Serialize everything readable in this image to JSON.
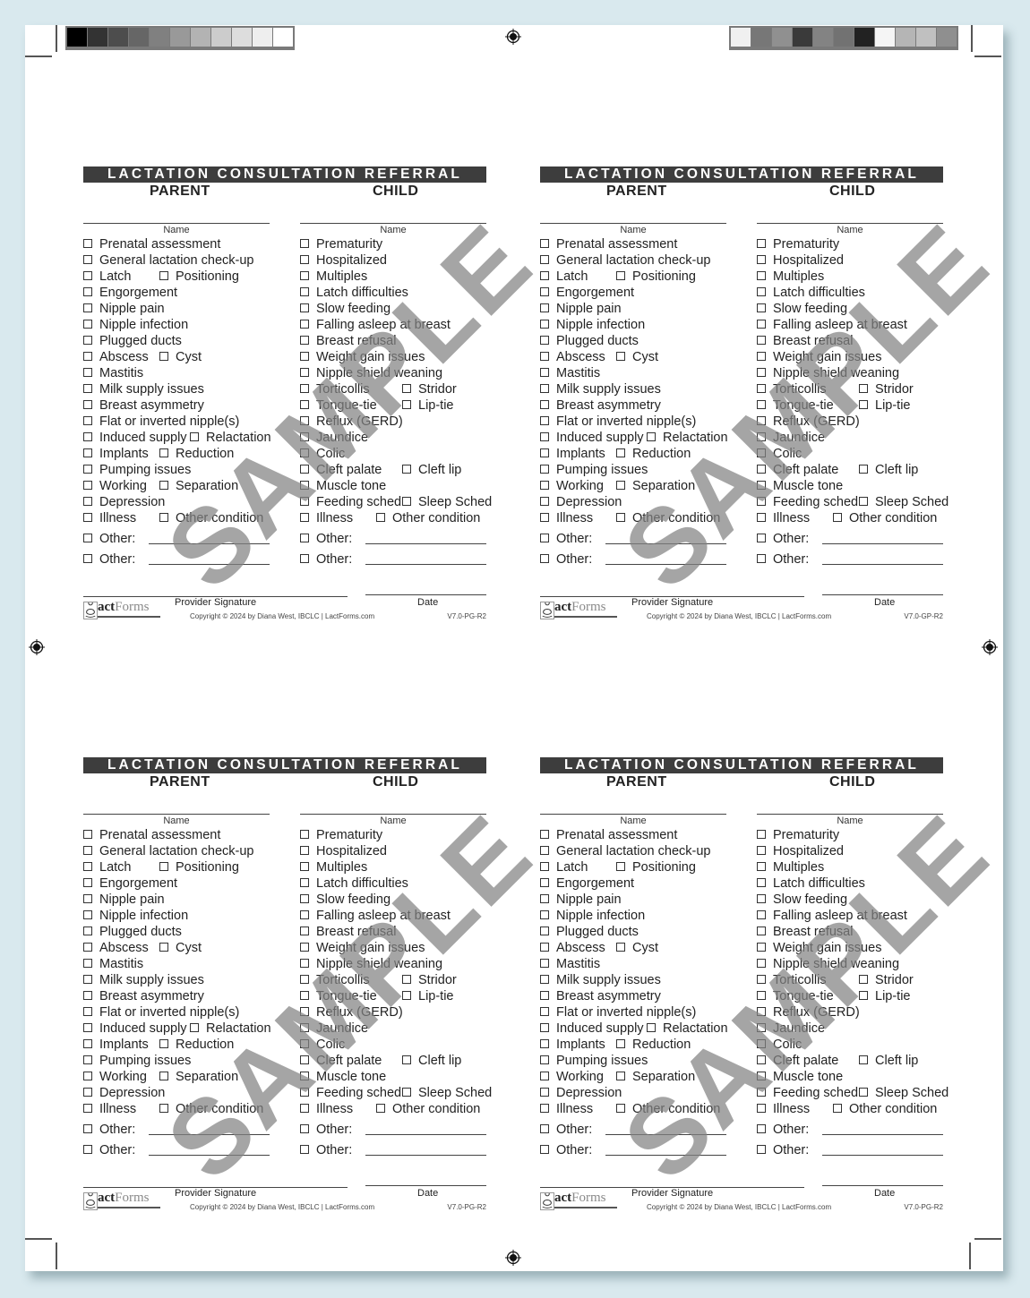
{
  "page": {
    "color_bar_left": [
      "#000000",
      "#333333",
      "#4d4d4d",
      "#666666",
      "#808080",
      "#999999",
      "#b3b3b3",
      "#cccccc",
      "#dddddd",
      "#eeeeee",
      "#ffffff"
    ],
    "color_bar_right": [
      "#f0f0f0",
      "#777777",
      "#909090",
      "#3a3a3a",
      "#838383",
      "#727272",
      "#222222",
      "#f5f5f5",
      "#b5b5b5",
      "#c0c0c0",
      "#8f8f8f"
    ]
  },
  "forms": [
    {
      "title": "LACTATION CONSULTATION REFERRAL",
      "parent_heading": "PARENT",
      "child_heading": "CHILD",
      "name_label": "Name",
      "watermark": "SAMPLE",
      "parent_items": [
        [
          "Prenatal assessment"
        ],
        [
          "General lactation check-up"
        ],
        [
          "Latch",
          "Positioning"
        ],
        [
          "Engorgement"
        ],
        [
          "Nipple pain"
        ],
        [
          "Nipple infection"
        ],
        [
          "Plugged ducts"
        ],
        [
          "Abscess",
          "Cyst"
        ],
        [
          "Mastitis"
        ],
        [
          "Milk supply issues"
        ],
        [
          "Breast asymmetry"
        ],
        [
          "Flat or inverted nipple(s)"
        ],
        [
          "Induced supply",
          "Relactation"
        ],
        [
          "Implants",
          "Reduction"
        ],
        [
          "Pumping issues"
        ],
        [
          "Working",
          "Separation"
        ],
        [
          "Depression"
        ],
        [
          "Illness",
          "Other condition"
        ]
      ],
      "child_items": [
        [
          "Prematurity"
        ],
        [
          "Hospitalized"
        ],
        [
          "Multiples"
        ],
        [
          "Latch difficulties"
        ],
        [
          "Slow feeding"
        ],
        [
          "Falling asleep at breast"
        ],
        [
          "Breast refusal"
        ],
        [
          "Weight gain issues"
        ],
        [
          "Nipple shield weaning"
        ],
        [
          "Torticollis",
          "Stridor"
        ],
        [
          "Tongue-tie",
          "Lip-tie"
        ],
        [
          "Reflux (GERD)"
        ],
        [
          "Jaundice"
        ],
        [
          "Colic"
        ],
        [
          "Cleft palate",
          "Cleft lip"
        ],
        [
          "Muscle tone"
        ],
        [
          "Feeding sched",
          "Sleep Sched"
        ],
        [
          "Illness",
          "Other condition"
        ]
      ],
      "other_label": "Other:",
      "signature_label": "Provider Signature",
      "date_label": "Date",
      "logo_text_a": "act",
      "logo_text_b": "Forms",
      "copyright": "Copyright © 2024 by Diana West, IBCLC  |  LactForms.com",
      "version": "V7.0-PG-R2"
    },
    {
      "title": "LACTATION CONSULTATION REFERRAL",
      "parent_heading": "PARENT",
      "child_heading": "CHILD",
      "name_label": "Name",
      "watermark": "SAMPLE",
      "other_label": "Other:",
      "signature_label": "Provider Signature",
      "date_label": "Date",
      "logo_text_a": "act",
      "logo_text_b": "Forms",
      "copyright": "Copyright © 2024 by Diana West, IBCLC  |  LactForms.com",
      "version": "V7.0-GP-R2"
    },
    {
      "title": "LACTATION CONSULTATION REFERRAL",
      "parent_heading": "PARENT",
      "child_heading": "CHILD",
      "name_label": "Name",
      "watermark": "SAMPLE",
      "other_label": "Other:",
      "signature_label": "Provider Signature",
      "date_label": "Date",
      "logo_text_a": "act",
      "logo_text_b": "Forms",
      "copyright": "Copyright © 2024 by Diana West, IBCLC  |  LactForms.com",
      "version": "V7.0-PG-R2"
    },
    {
      "title": "LACTATION CONSULTATION REFERRAL",
      "parent_heading": "PARENT",
      "child_heading": "CHILD",
      "name_label": "Name",
      "watermark": "SAMPLE",
      "other_label": "Other:",
      "signature_label": "Provider Signature",
      "date_label": "Date",
      "logo_text_a": "act",
      "logo_text_b": "Forms",
      "copyright": "Copyright © 2024 by Diana West, IBCLC  |  LactForms.com",
      "version": "V7.0-PG-R2"
    }
  ]
}
